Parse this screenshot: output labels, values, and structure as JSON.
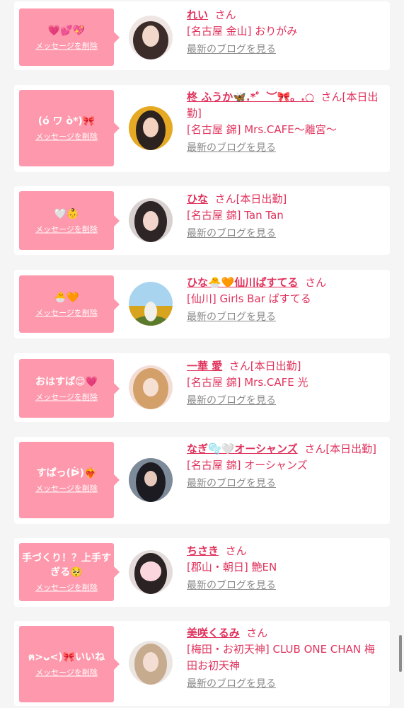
{
  "delete_label": "メッセージを削除",
  "san_label": "さん",
  "blog_label": "最新のブログを見る",
  "colors": {
    "bubble": "#fe98ac",
    "name": "#e0325c",
    "link": "#8a8a8a",
    "background": "#f5f5f5"
  },
  "entries": [
    {
      "message": "💗💕💖",
      "name": "れい",
      "status": "",
      "shop": "[名古屋 金山] おりがみ",
      "avatar": "photo-woman-long-hair"
    },
    {
      "message": "(ó ワ ò*)🎀",
      "name": "柊 ふうか🦋.*゜︶🎀。.○",
      "status": "[本日出勤]",
      "shop": "[名古屋 錦] Mrs.CAFE〜離宮〜",
      "avatar": "photo-woman-gold-background"
    },
    {
      "message": "🤍👶",
      "name": "ひな",
      "status": "[本日出勤]",
      "shop": "[名古屋 錦] Tan Tan",
      "avatar": "photo-woman-bangs"
    },
    {
      "message": "🐣🧡",
      "name": "ひな🐣🧡仙川ぱすてる",
      "status": "",
      "shop": "[仙川] Girls Bar ぱすてる",
      "avatar": "photo-sunflower-field"
    },
    {
      "message": "おはすぱ😊💗",
      "name": "一華 愛",
      "status": "[本日出勤]",
      "shop": "[名古屋 錦] Mrs.CAFE 光",
      "avatar": "photo-woman-blonde"
    },
    {
      "message": "すぱっ(ᐖ)❤️‍🔥",
      "name": "なぎ🫧🤍オーシャンズ",
      "status": "[本日出勤]",
      "shop": "[名古屋 錦] オーシャンズ",
      "avatar": "photo-woman-dark-room"
    },
    {
      "message": "手づくり！？上手すぎる🥺",
      "name": "ちさき",
      "status": "",
      "shop": "[郡山・朝日] 艶EN",
      "avatar": "photo-woman-heart-sticker"
    },
    {
      "message": "ฅ>ᴗ<)🎀いいね",
      "name": "美咲くるみ",
      "status": "",
      "shop": "[梅田・お初天神] CLUB ONE CHAN 梅田お初天神",
      "avatar": "photo-woman-light-hair"
    }
  ]
}
